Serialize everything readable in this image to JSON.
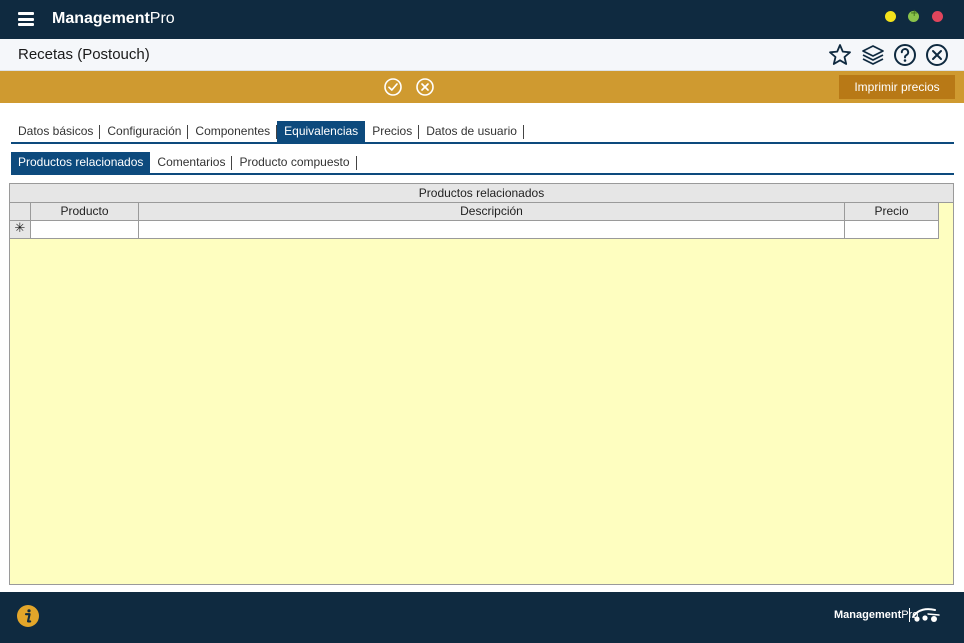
{
  "app": {
    "title_bold": "Management",
    "title_light": "Pro"
  },
  "colors": {
    "titlebar": "#0f2a40",
    "actionbar": "#cf9a30",
    "print_button": "#b87916",
    "active_tab": "#0d4a7d",
    "grid_background": "#fefec0"
  },
  "header": {
    "title": "Recetas (Postouch)",
    "icons": [
      "star-icon",
      "layers-icon",
      "help-icon",
      "close-icon"
    ]
  },
  "actionbar": {
    "icons": [
      "check-circle-icon",
      "cancel-circle-icon"
    ],
    "print_label": "Imprimir precios"
  },
  "tabs": {
    "main": [
      {
        "label": "Datos básicos"
      },
      {
        "label": "Configuración"
      },
      {
        "label": "Componentes"
      },
      {
        "label": "Equivalencias",
        "active": true
      },
      {
        "label": "Precios"
      },
      {
        "label": "Datos de usuario"
      }
    ],
    "sub": [
      {
        "label": "Productos relacionados",
        "active": true
      },
      {
        "label": "Comentarios"
      },
      {
        "label": "Producto compuesto"
      }
    ]
  },
  "grid": {
    "caption": "Productos relacionados",
    "columns": [
      "Producto",
      "Descripción",
      "Precio"
    ],
    "new_row_marker": "✳"
  },
  "footer": {
    "brand_bold": "Management",
    "brand_light": "Pro",
    "icons": [
      "info-icon",
      "brand-logo-icon"
    ]
  }
}
